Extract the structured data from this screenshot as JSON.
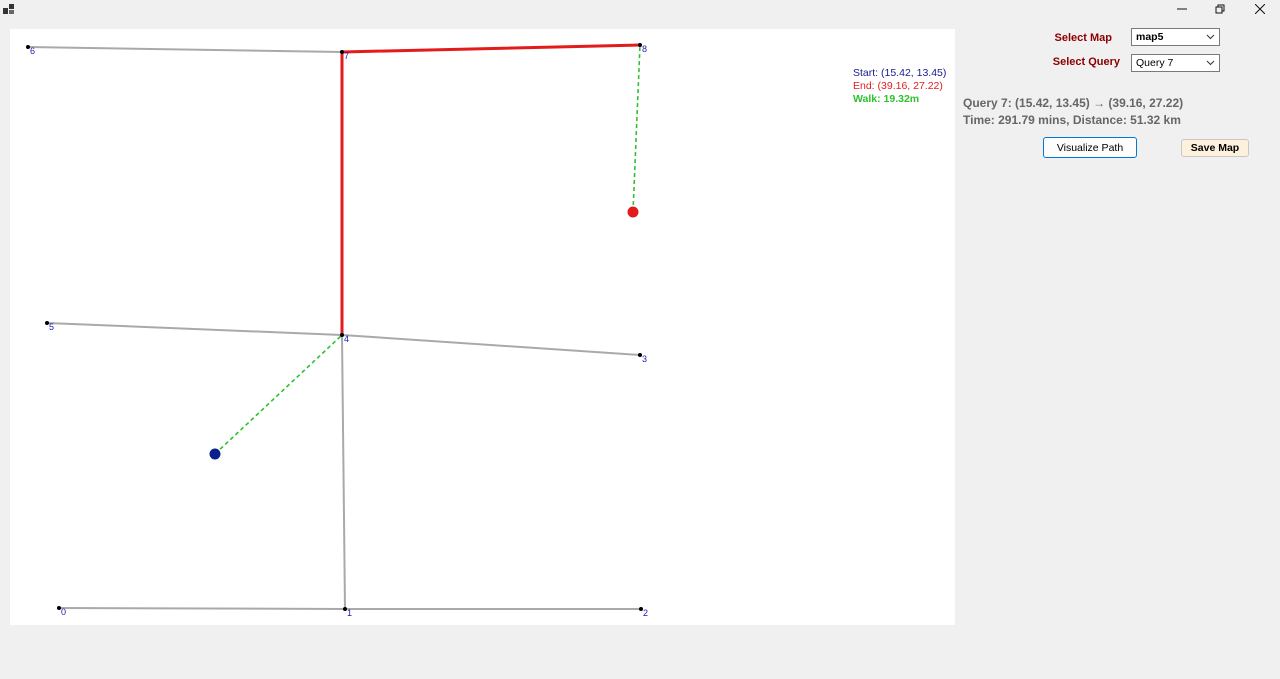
{
  "window": {
    "title": "",
    "icons": {
      "app": "app-icon",
      "minimize": "minimize-icon",
      "restore": "restore-icon",
      "close": "close-icon"
    }
  },
  "info": {
    "start": "Start: (15.42, 13.45)",
    "end": "End: (39.16, 27.22)",
    "walk": "Walk: 19.32m",
    "colors": {
      "start": "#1a1a8c",
      "end": "#e02020",
      "walk": "#2fc12f"
    }
  },
  "controls": {
    "select_map_label": "Select Map",
    "map_value": "map5",
    "select_query_label": "Select Query",
    "query_value": "Query 7",
    "visualize_label": "Visualize Path",
    "save_label": "Save Map"
  },
  "result": {
    "summary": "Query 7: (15.42, 13.45) → (39.16, 27.22)",
    "stats": "Time: 291.79 mins, Distance: 51.32 km"
  },
  "map": {
    "node_labels": [
      "0",
      "1",
      "2",
      "3",
      "4",
      "5",
      "6",
      "7",
      "8"
    ],
    "edges": [
      [
        0,
        1
      ],
      [
        1,
        2
      ],
      [
        1,
        4
      ],
      [
        3,
        4
      ],
      [
        4,
        5
      ],
      [
        6,
        7
      ],
      [
        4,
        7
      ],
      [
        7,
        8
      ]
    ],
    "path": [
      4,
      7,
      8
    ],
    "colors": {
      "edge": "#a9a9a9",
      "path": "#e31b1b",
      "walk": "#2fc12f",
      "node": "#000000",
      "label": "#1a1ab4",
      "start_marker": "#0a1e8c",
      "end_marker": "#e31b1b"
    }
  }
}
